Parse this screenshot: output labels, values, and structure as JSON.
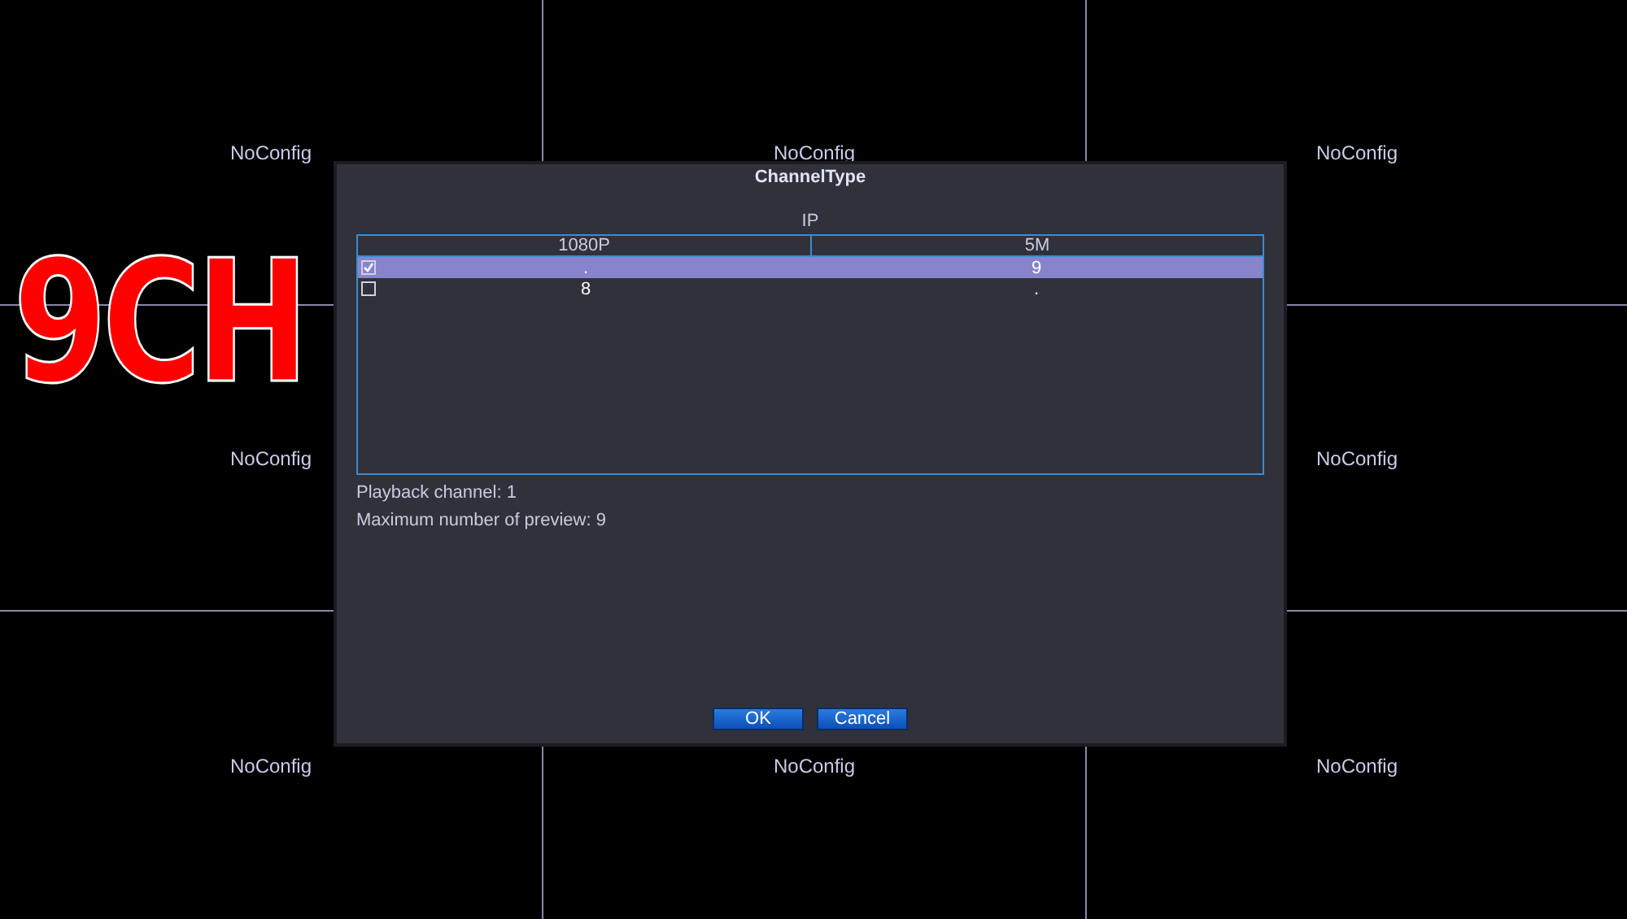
{
  "cells": [
    {
      "label": "NoConfig"
    },
    {
      "label": "NoConfig"
    },
    {
      "label": "NoConfig"
    },
    {
      "label": "NoConfig"
    },
    {},
    {
      "label": "NoConfig"
    },
    {
      "label": "NoConfig"
    },
    {
      "label": "NoConfig"
    },
    {
      "label": "NoConfig"
    }
  ],
  "badge": "9CH",
  "dialog": {
    "title": "ChannelType",
    "group": "IP",
    "table": {
      "columns": [
        "1080P",
        "5M"
      ],
      "rows": [
        {
          "checked": true,
          "selected": true,
          "cells": [
            ".",
            "9"
          ]
        },
        {
          "checked": false,
          "selected": false,
          "cells": [
            "8",
            "."
          ]
        }
      ]
    },
    "info": [
      "Playback channel: 1",
      "Maximum number of preview: 9"
    ],
    "buttons": [
      "OK",
      "Cancel"
    ]
  }
}
